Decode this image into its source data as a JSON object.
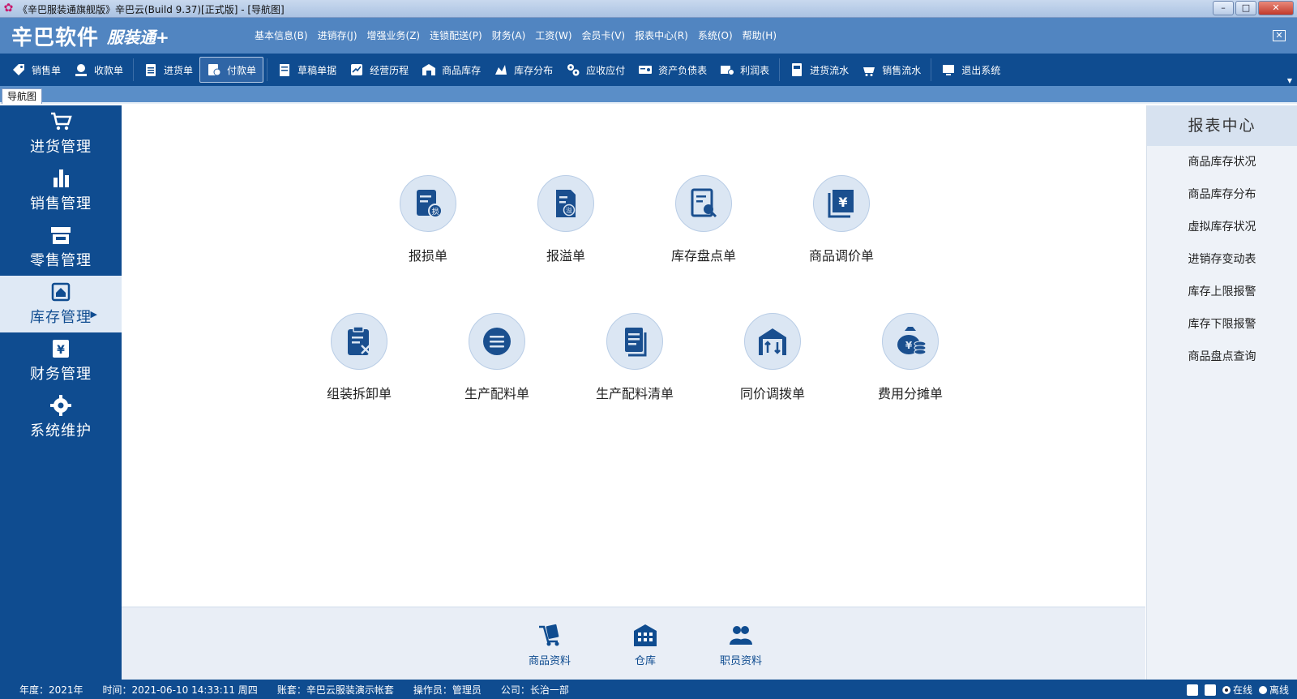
{
  "window": {
    "title": "《辛巴服装通旗舰版》辛巴云(Build 9.37)[正式版] - [导航图]",
    "controls": [
      "–",
      "□",
      "✕"
    ]
  },
  "header": {
    "brand": "辛巴软件",
    "product": "服装通+",
    "close_label": "✕",
    "menu": [
      "基本信息(B)",
      "进销存(J)",
      "增强业务(Z)",
      "连锁配送(P)",
      "财务(A)",
      "工资(W)",
      "会员卡(V)",
      "报表中心(R)",
      "系统(O)",
      "帮助(H)"
    ]
  },
  "toolbar": {
    "buttons": [
      {
        "label": "销售单",
        "icon": "tag-icon"
      },
      {
        "label": "收款单",
        "icon": "coin-hand-icon"
      },
      {
        "label": "进货单",
        "icon": "clipboard-icon"
      },
      {
        "label": "付款单",
        "icon": "payment-doc-icon",
        "active": true
      },
      {
        "label": "草稿单据",
        "icon": "draft-icon"
      },
      {
        "label": "经营历程",
        "icon": "trend-icon"
      },
      {
        "label": "商品库存",
        "icon": "warehouse-icon"
      },
      {
        "label": "库存分布",
        "icon": "distribution-icon"
      },
      {
        "label": "应收应付",
        "icon": "gears-icon"
      },
      {
        "label": "资产负债表",
        "icon": "balance-sheet-icon"
      },
      {
        "label": "利润表",
        "icon": "profit-icon"
      },
      {
        "label": "进货流水",
        "icon": "purchase-flow-icon"
      },
      {
        "label": "销售流水",
        "icon": "sales-flow-icon"
      },
      {
        "label": "退出系统",
        "icon": "exit-icon"
      }
    ]
  },
  "doc_tab": "导航图",
  "sidebar": {
    "items": [
      {
        "label": "进货管理",
        "icon": "cart-icon"
      },
      {
        "label": "销售管理",
        "icon": "bar-chart-icon"
      },
      {
        "label": "零售管理",
        "icon": "store-icon"
      },
      {
        "label": "库存管理",
        "icon": "home-stock-icon",
        "active": true
      },
      {
        "label": "财务管理",
        "icon": "yen-box-icon"
      },
      {
        "label": "系统维护",
        "icon": "gear-icon"
      }
    ],
    "active_caret": "▶"
  },
  "main": {
    "tiles": [
      {
        "label": "报损单",
        "icon": "loss-report-icon"
      },
      {
        "label": "报溢单",
        "icon": "overflow-report-icon"
      },
      {
        "label": "库存盘点单",
        "icon": "stocktake-icon"
      },
      {
        "label": "商品调价单",
        "icon": "price-adjust-icon"
      },
      {
        "label": "组装拆卸单",
        "icon": "assembly-icon"
      },
      {
        "label": "生产配料单",
        "icon": "production-icon"
      },
      {
        "label": "生产配料清单",
        "icon": "production-list-icon"
      },
      {
        "label": "同价调拨单",
        "icon": "transfer-icon"
      },
      {
        "label": "费用分摊单",
        "icon": "money-bag-icon"
      }
    ]
  },
  "bottom": {
    "items": [
      {
        "label": "商品资料",
        "icon": "goods-cart-icon"
      },
      {
        "label": "仓库",
        "icon": "warehouse-building-icon"
      },
      {
        "label": "职员资料",
        "icon": "staff-icon"
      }
    ]
  },
  "report_center": {
    "title": "报表中心",
    "links": [
      "商品库存状况",
      "商品库存分布",
      "虚拟库存状况",
      "进销存变动表",
      "库存上限报警",
      "库存下限报警",
      "商品盘点查询"
    ]
  },
  "status": {
    "year": "年度：2021年",
    "time": "时间：2021-06-10 14:33:11 周四",
    "account": "账套：辛巴云服装演示帐套",
    "operator": "操作员：管理员",
    "company": "公司：长治一部",
    "online": "在线",
    "offline": "离线"
  },
  "colors": {
    "primary": "#0f4c90",
    "header": "#5185c1",
    "icon_circle": "#dbe6f3",
    "icon_fill": "#1a4f8f"
  }
}
